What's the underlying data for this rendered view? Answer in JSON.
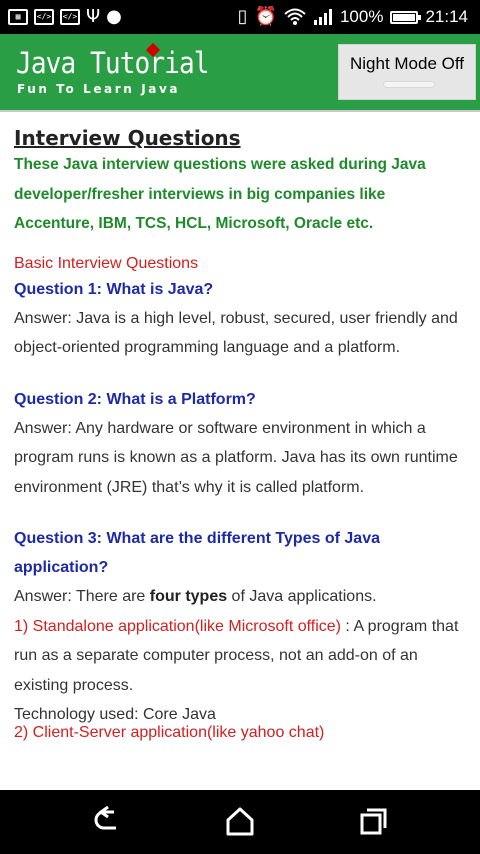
{
  "status_bar": {
    "icons": [
      "gallery-icon",
      "code-icon",
      "code-icon",
      "usb-icon",
      "android-icon",
      "vibrate-icon",
      "alarm-icon",
      "wifi-icon",
      "signal-icon",
      "battery-icon"
    ],
    "battery": "100%",
    "battery_level": 1.0,
    "time": "21:14"
  },
  "header": {
    "logo_title": "Java Tutorial",
    "logo_subtitle": "Fun To Learn Java",
    "night_mode_label": "Night Mode Off",
    "night_mode_on": false,
    "colors": {
      "bar": "#2a9e44",
      "diamond": "#d10000"
    }
  },
  "content": {
    "page_title": "Interview Questions",
    "intro": "These Java interview questions were asked during Java developer/fresher interviews in big companies like Accenture, IBM, TCS, HCL, Microsoft, Oracle etc.",
    "section_label": "Basic Interview Questions",
    "questions": [
      {
        "title": "Question 1: What is Java?",
        "answer": "Answer: Java is a high level, robust, secured, user friendly and object-oriented programming language and a platform."
      },
      {
        "title": "Question 2: What is a Platform?",
        "answer": "Answer: Any hardware or software environment in which a program runs is known as a platform. Java has its own runtime environment (JRE) that’s why it is called platform."
      },
      {
        "title": "Question 3: What are the different Types of Java application?",
        "answer_prefix": "Answer: There are ",
        "answer_bold": "four types",
        "answer_suffix": " of Java applications.",
        "item1_red": "1) Standalone application(like Microsoft office)",
        "item1_rest": " : A program that run as a separate computer process, not an add-on of an existing process.",
        "technology": "Technology used: Core Java",
        "item2_partial": "2) Client-Server application(like yahoo chat)"
      }
    ]
  },
  "nav_bar": {
    "buttons": [
      "back-icon",
      "home-icon",
      "recents-icon"
    ]
  }
}
